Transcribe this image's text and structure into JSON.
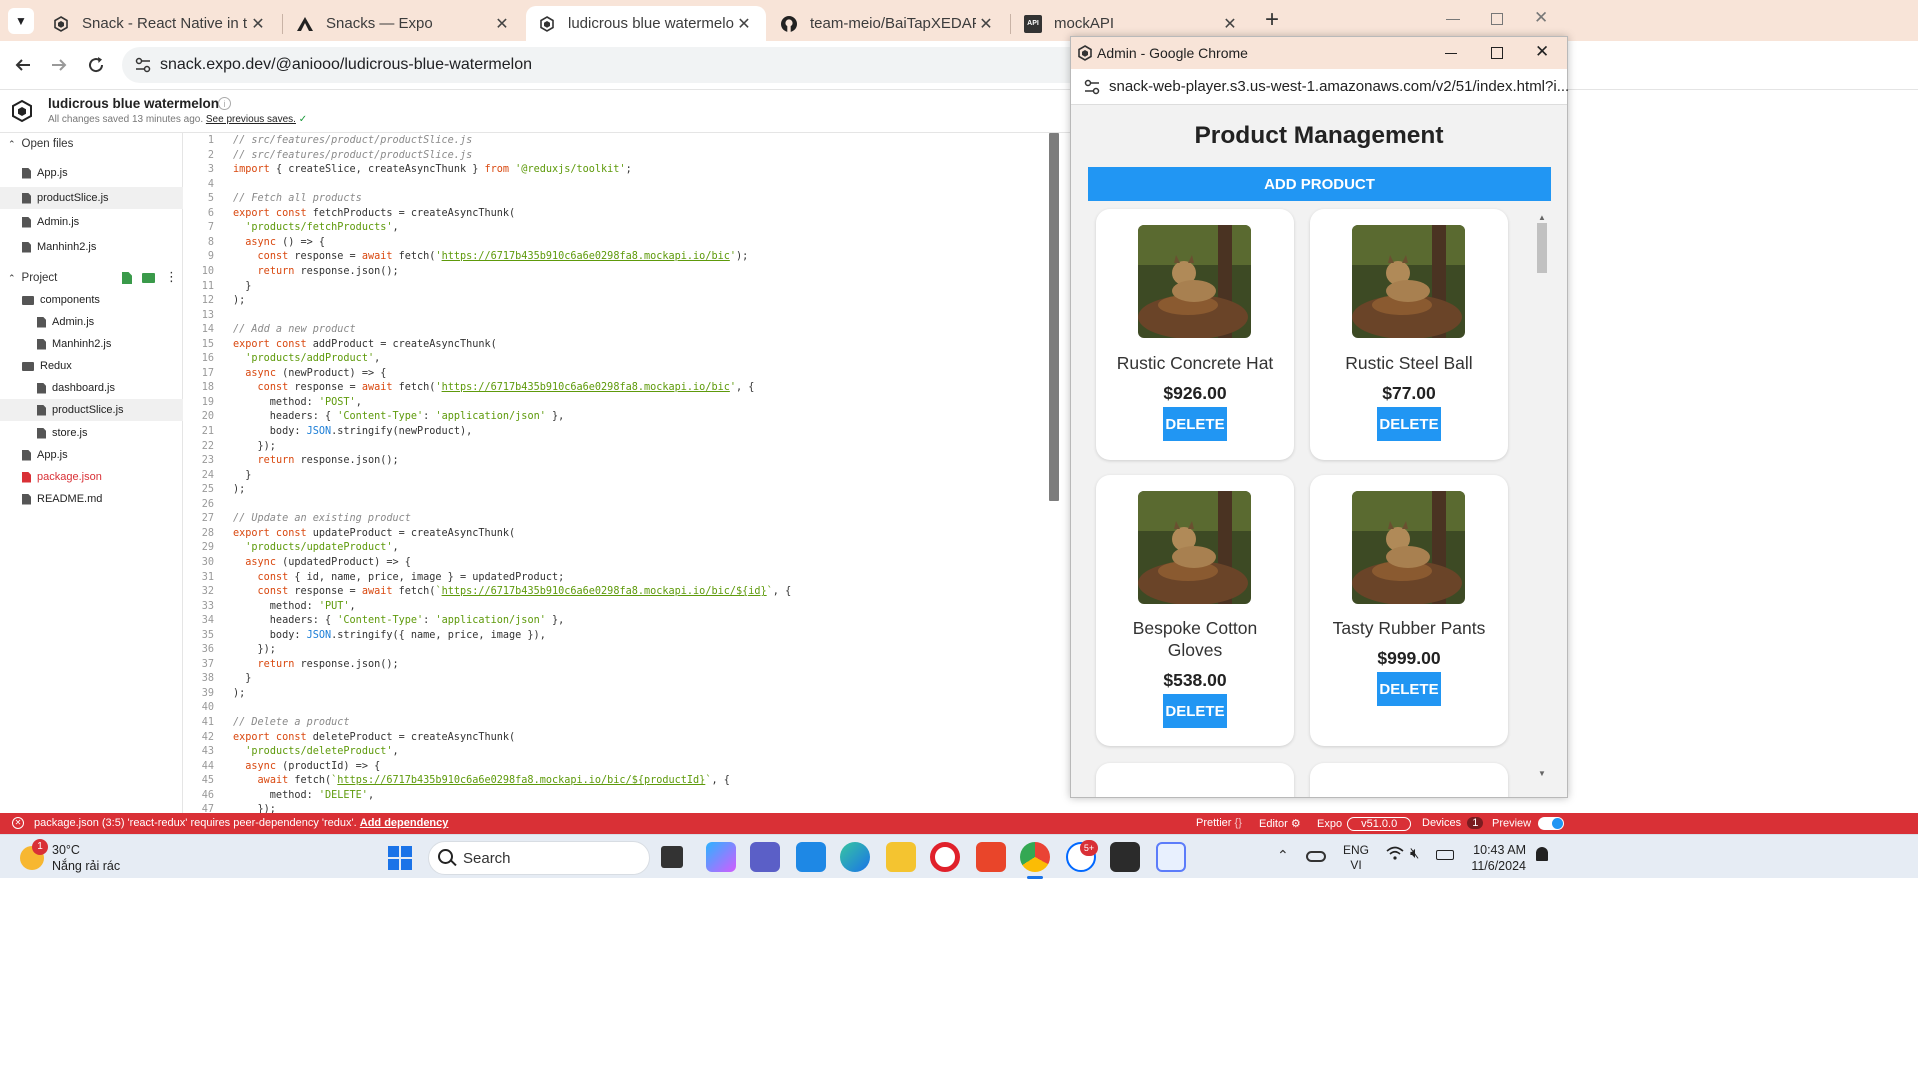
{
  "browser": {
    "tabs": [
      {
        "title": "Snack - React Native in the browser",
        "icon": "snack-icon",
        "active": false
      },
      {
        "title": "Snacks — Expo",
        "icon": "expo-icon",
        "active": false
      },
      {
        "title": "ludicrous blue watermelon - Snack",
        "icon": "snack-icon",
        "active": true
      },
      {
        "title": "team-meio/BaiTapXEDAP",
        "icon": "github-icon",
        "active": false
      },
      {
        "title": "mockAPI",
        "icon": "mockapi-icon",
        "active": false
      }
    ],
    "new_tab": "+",
    "address": "snack.expo.dev/@aniooo/ludicrous-blue-watermelon"
  },
  "snack": {
    "project_name": "ludicrous blue watermelon",
    "saved_status": "All changes saved 13 minutes ago.",
    "see_saves_link": "See previous saves.",
    "sidebar": {
      "open_files_label": "Open files",
      "open_files": [
        "App.js",
        "productSlice.js",
        "Admin.js",
        "Manhinh2.js"
      ],
      "project_label": "Project",
      "tree": [
        {
          "name": "components",
          "type": "folder",
          "indent": 1
        },
        {
          "name": "Admin.js",
          "type": "file",
          "indent": 2
        },
        {
          "name": "Manhinh2.js",
          "type": "file",
          "indent": 2
        },
        {
          "name": "Redux",
          "type": "folder",
          "indent": 1
        },
        {
          "name": "dashboard.js",
          "type": "file",
          "indent": 2
        },
        {
          "name": "productSlice.js",
          "type": "file",
          "indent": 2,
          "selected": true
        },
        {
          "name": "store.js",
          "type": "file",
          "indent": 2
        },
        {
          "name": "App.js",
          "type": "file",
          "indent": 1
        },
        {
          "name": "package.json",
          "type": "file",
          "indent": 1,
          "error": true
        },
        {
          "name": "README.md",
          "type": "file",
          "indent": 1
        }
      ]
    },
    "status_bar": {
      "error_text": "package.json (3:5) 'react-redux' requires peer-dependency 'redux'.",
      "error_link": "Add dependency",
      "prettier": "Prettier",
      "editor": "Editor",
      "expo": "Expo",
      "sdk_version": "v51.0.0",
      "devices": "Devices",
      "devices_count": "1",
      "preview": "Preview"
    }
  },
  "code_lines": [
    "<span class='cm'>// src/features/product/productSlice.js</span>",
    "<span class='cm'>// src/features/product/productSlice.js</span>",
    "<span class='kw'>import</span> { createSlice, createAsyncThunk } <span class='kw'>from</span> <span class='st'>'@reduxjs/toolkit'</span>;",
    "",
    "<span class='cm'>// Fetch all products</span>",
    "<span class='kw'>export const</span> fetchProducts = createAsyncThunk(",
    "  <span class='st'>'products/fetchProducts'</span>,",
    "  <span class='kw'>async</span> () => {",
    "    <span class='kw'>const</span> response = <span class='kw'>await</span> fetch(<span class='st'>'</span><span class='ur'>https://6717b435b910c6a6e0298fa8.mockapi.io/bic</span><span class='st'>'</span>);",
    "    <span class='kw'>return</span> response.json();",
    "  }",
    ");",
    "",
    "<span class='cm'>// Add a new product</span>",
    "<span class='kw'>export const</span> addProduct = createAsyncThunk(",
    "  <span class='st'>'products/addProduct'</span>,",
    "  <span class='kw'>async</span> (newProduct) => {",
    "    <span class='kw'>const</span> response = <span class='kw'>await</span> fetch(<span class='st'>'</span><span class='ur'>https://6717b435b910c6a6e0298fa8.mockapi.io/bic</span><span class='st'>'</span>, {",
    "      method: <span class='st'>'POST'</span>,",
    "      headers: { <span class='st'>'Content-Type'</span>: <span class='st'>'application/json'</span> },",
    "      body: <span class='bl'>JSON</span>.stringify(newProduct),",
    "    });",
    "    <span class='kw'>return</span> response.json();",
    "  }",
    ");",
    "",
    "<span class='cm'>// Update an existing product</span>",
    "<span class='kw'>export const</span> updateProduct = createAsyncThunk(",
    "  <span class='st'>'products/updateProduct'</span>,",
    "  <span class='kw'>async</span> (updatedProduct) => {",
    "    <span class='kw'>const</span> { id, name, price, image } = updatedProduct;",
    "    <span class='kw'>const</span> response = <span class='kw'>await</span> fetch(<span class='st'>`</span><span class='ur'>https://6717b435b910c6a6e0298fa8.mockapi.io/bic/${id}</span><span class='st'>`</span>, {",
    "      method: <span class='st'>'PUT'</span>,",
    "      headers: { <span class='st'>'Content-Type'</span>: <span class='st'>'application/json'</span> },",
    "      body: <span class='bl'>JSON</span>.stringify({ name, price, image }),",
    "    });",
    "    <span class='kw'>return</span> response.json();",
    "  }",
    ");",
    "",
    "<span class='cm'>// Delete a product</span>",
    "<span class='kw'>export const</span> deleteProduct = createAsyncThunk(",
    "  <span class='st'>'products/deleteProduct'</span>,",
    "  <span class='kw'>async</span> (productId) => {",
    "    <span class='kw'>await</span> fetch(<span class='st'>`</span><span class='ur'>https://6717b435b910c6a6e0298fa8.mockapi.io/bic/${productId}</span><span class='st'>`</span>, {",
    "      method: <span class='st'>'DELETE'</span>,",
    "    });"
  ],
  "popup": {
    "window_title": "Admin - Google Chrome",
    "url": "snack-web-player.s3.us-west-1.amazonaws.com/v2/51/index.html?i...",
    "heading": "Product Management",
    "add_button": "ADD PRODUCT",
    "products": [
      {
        "name": "Rustic Concrete Hat",
        "price": "$926.00"
      },
      {
        "name": "Rustic Steel Ball",
        "price": "$77.00"
      },
      {
        "name": "Bespoke Cotton Gloves",
        "price": "$538.00"
      },
      {
        "name": "Tasty Rubber Pants",
        "price": "$999.00"
      }
    ],
    "delete_label": "DELETE"
  },
  "taskbar": {
    "weather_temp": "30°C",
    "weather_desc": "Nắng rải rác",
    "weather_badge": "1",
    "search_label": "Search",
    "lang_top": "ENG",
    "lang_bottom": "VI",
    "time": "10:43 AM",
    "date": "11/6/2024",
    "zalo_badge": "5+"
  },
  "colors": {
    "tabstrip": "#f8e4d8",
    "accent_blue": "#2196f3",
    "error_red": "#d93036"
  }
}
